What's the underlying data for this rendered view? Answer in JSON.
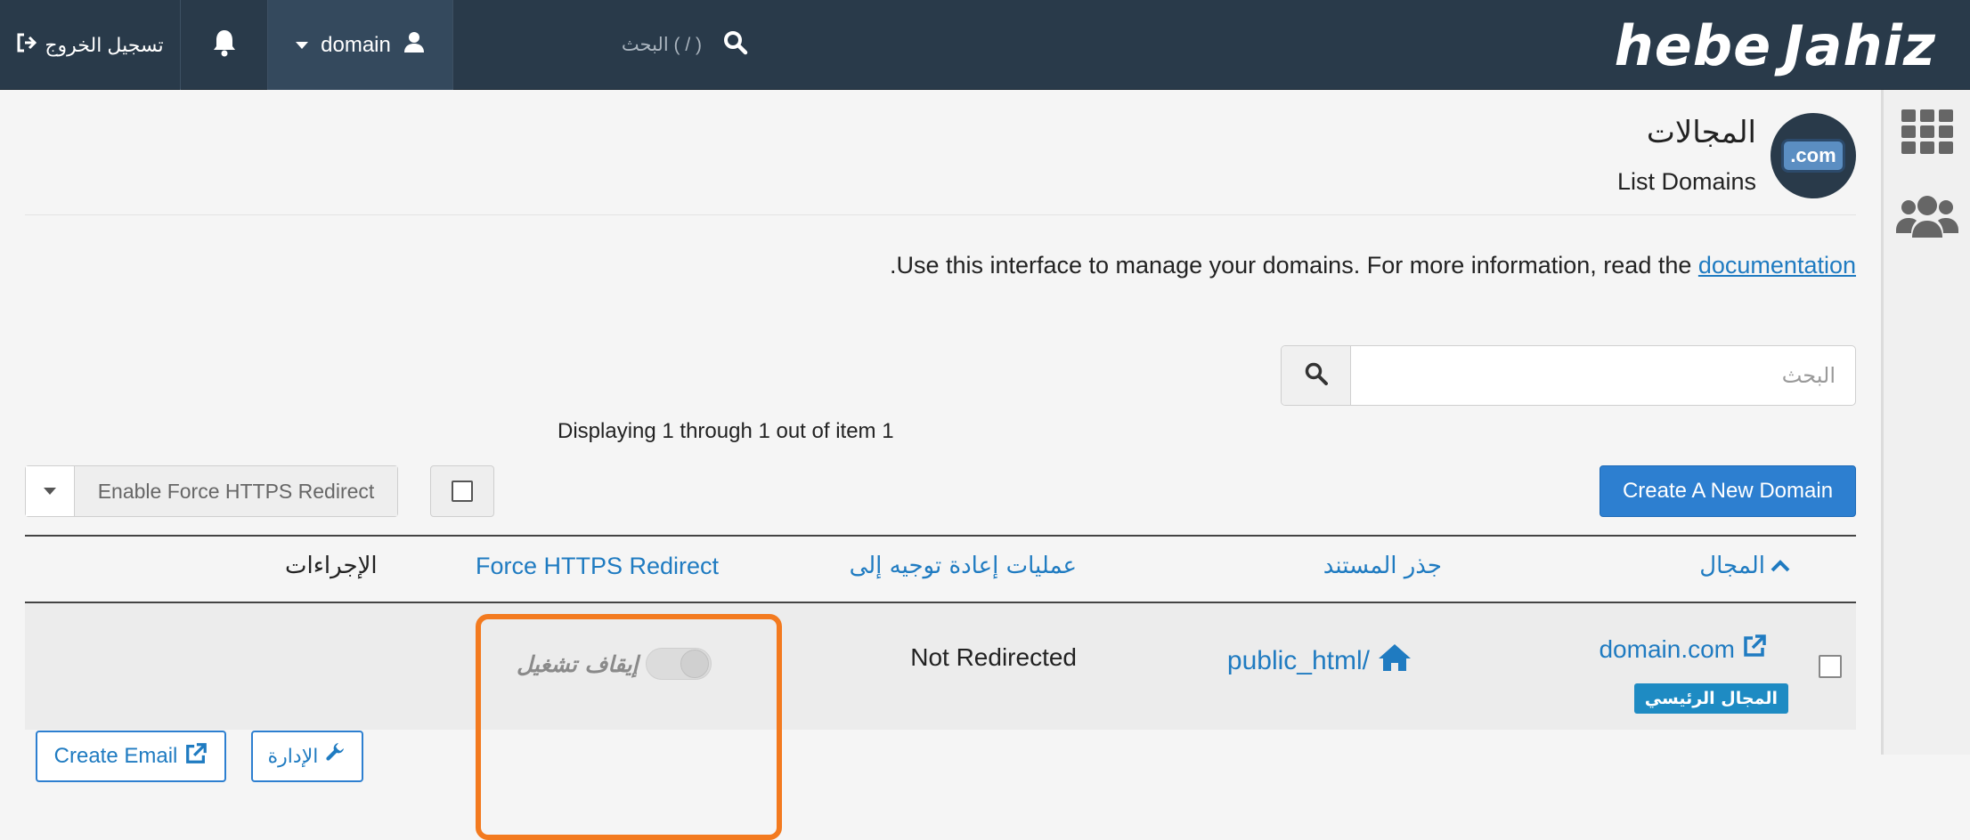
{
  "topbar": {
    "logout_label": "تسجيل الخروج",
    "username": "domain",
    "search_placeholder": "البحث ( / )",
    "logo_text": "hebe Jahiz"
  },
  "page": {
    "title_ar": "المجالات",
    "title_en": "List Domains",
    "icon_label": ".com",
    "intro_text": ".Use this interface to manage your domains. For more information, read the ",
    "intro_link": "documentation"
  },
  "toolbar": {
    "search_placeholder": "البحث",
    "displaying_text": "Displaying 1 through 1 out of item 1",
    "bulk_action_label": "Enable Force HTTPS Redirect",
    "create_domain_label": "Create A New Domain"
  },
  "table": {
    "headers": {
      "domain": "المجال",
      "document_root": "جذر المستند",
      "redirects": "عمليات إعادة توجيه إلى",
      "force_https": "Force HTTPS Redirect",
      "actions": "الإجراءات"
    },
    "rows": [
      {
        "domain": "domain.com",
        "badge": "المجال الرئيسي",
        "document_root": "public_html/",
        "redirects": "Not Redirected",
        "force_https_label": "إيقاف تشغيل",
        "force_https_enabled": false,
        "manage_label": "الإدارة",
        "create_email_label": "Create Email"
      }
    ]
  },
  "colors": {
    "topbar": "#293a4a",
    "link": "#1f7bc1",
    "primary_button": "#2d7fd0",
    "highlight": "#f37a1f",
    "badge": "#1e8bc3"
  }
}
